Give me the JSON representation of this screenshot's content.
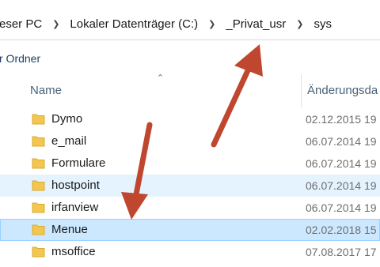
{
  "address_bar": {
    "crumbs": [
      "eser PC",
      "Lokaler Datenträger (C:)",
      "_Privat_usr",
      "sys"
    ]
  },
  "toolbar": {
    "new_folder_label": "r Ordner"
  },
  "columns": {
    "name": "Name",
    "date": "Änderungsda"
  },
  "files": [
    {
      "name": "Dymo",
      "date": "02.12.2015 19"
    },
    {
      "name": "e_mail",
      "date": "06.07.2014 19"
    },
    {
      "name": "Formulare",
      "date": "06.07.2014 19"
    },
    {
      "name": "hostpoint",
      "date": "06.07.2014 19"
    },
    {
      "name": "irfanview",
      "date": "06.07.2014 19"
    },
    {
      "name": "Menue",
      "date": "02.02.2018 15"
    },
    {
      "name": "msoffice",
      "date": "07.08.2017 17"
    }
  ],
  "colors": {
    "folder": "#f3c650",
    "folder_dark": "#deaa2e",
    "hover_row": "#e5f3ff",
    "selected_row": "#cce8ff",
    "annotation_arrow": "#c0472f"
  },
  "icons": {
    "separator": "chevron-right-icon",
    "sort": "sort-ascending-icon",
    "folder": "folder-icon"
  }
}
